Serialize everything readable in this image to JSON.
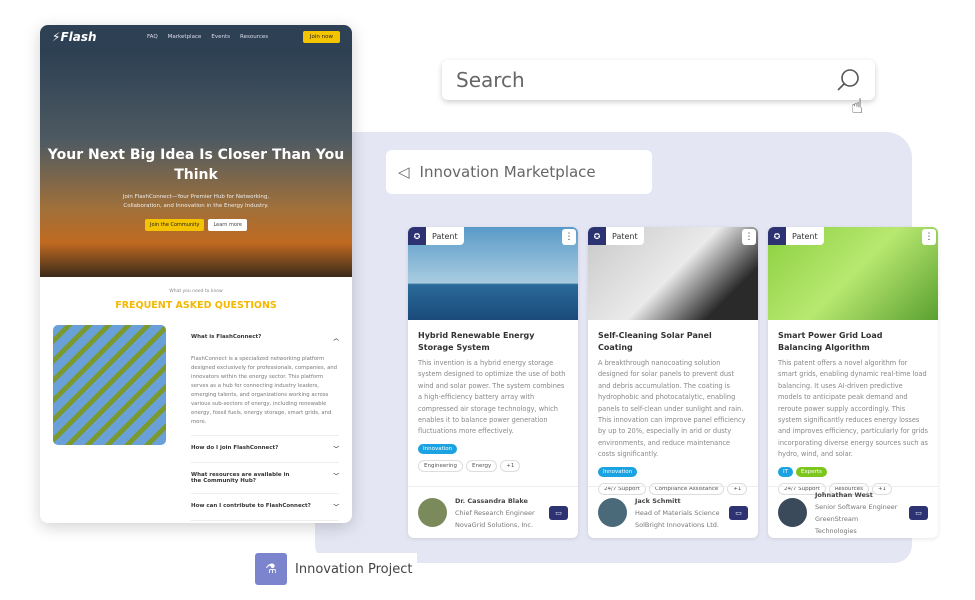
{
  "site": {
    "logo": "Flash",
    "nav": [
      "FAQ",
      "Marketplace",
      "Events",
      "Resources"
    ],
    "join_now": "Join now",
    "hero_title": "Your Next Big Idea Is Closer Than You Think",
    "hero_text": "Join FlashConnect—Your Premier Hub for Networking, Collaboration, and Innovation in the Energy Industry.",
    "cta_primary": "Join the Community",
    "cta_secondary": "Learn more",
    "faq_kicker": "What you need to know",
    "faq_title": "FREQUENT ASKED QUESTIONS",
    "faqs": [
      {
        "q": "What is FlashConnect?",
        "a": "FlashConnect is a specialized networking platform designed exclusively for professionals, companies, and innovators within the energy sector. This platform serves as a hub for connecting industry leaders, emerging talents, and organizations working across various sub-sectors of energy, including renewable energy, fossil fuels, energy storage, smart grids, and more."
      },
      {
        "q": "How do I join FlashConnect?"
      },
      {
        "q": "What resources are available in the Community Hub?"
      },
      {
        "q": "How can I contribute to FlashConnect?"
      }
    ]
  },
  "search": {
    "placeholder": "Search"
  },
  "marketplace": {
    "label": "Innovation Marketplace"
  },
  "cards": [
    {
      "badge": "Patent",
      "title": "Hybrid Renewable Energy Storage System",
      "desc": "This invention is a hybrid energy storage system designed to optimize the use of both wind and solar power. The system combines a high-efficiency battery array with compressed air storage technology, which enables it to balance power generation fluctuations more effectively.",
      "tags": [
        "Innovation"
      ],
      "other": [
        "Engineering",
        "Energy",
        "+1"
      ],
      "name": "Dr. Cassandra Blake",
      "role": "Chief Research Engineer",
      "company": "NovaGrid Solutions, Inc."
    },
    {
      "badge": "Patent",
      "title": "Self-Cleaning Solar Panel Coating",
      "desc": "A breakthrough nanocoating solution designed for solar panels to prevent dust and debris accumulation. The coating is hydrophobic and photocatalytic, enabling panels to self-clean under sunlight and rain. This innovation can improve panel efficiency by up to 20%, especially in arid or dusty environments, and reduce maintenance costs significantly.",
      "tags": [
        "Innovation"
      ],
      "other": [
        "24/7 Support",
        "Compliance Assistance",
        "+1"
      ],
      "name": "Jack Schmitt",
      "role": "Head of Materials Science",
      "company": "SolBright Innovations Ltd."
    },
    {
      "badge": "Patent",
      "title": "Smart Power Grid Load Balancing Algorithm",
      "desc": "This patent offers a novel algorithm for smart grids, enabling dynamic real-time load balancing. It uses AI-driven predictive models to anticipate peak demand and reroute power supply accordingly. This system significantly reduces energy losses and improves efficiency, particularly for grids incorporating diverse energy sources such as hydro, wind, and solar.",
      "tags": [
        "IT",
        "Experts"
      ],
      "other": [
        "24/7 Support",
        "Resources",
        "+1"
      ],
      "name": "Johnathan West",
      "role": "Senior Software Engineer",
      "company": "GreenStream Technologies"
    }
  ],
  "project": {
    "label": "Innovation Project"
  },
  "colors": {
    "navy": "#2c3272",
    "accent": "#f5c400",
    "tag_blue": "#1aa3e0",
    "tag_green": "#7dc61e"
  }
}
